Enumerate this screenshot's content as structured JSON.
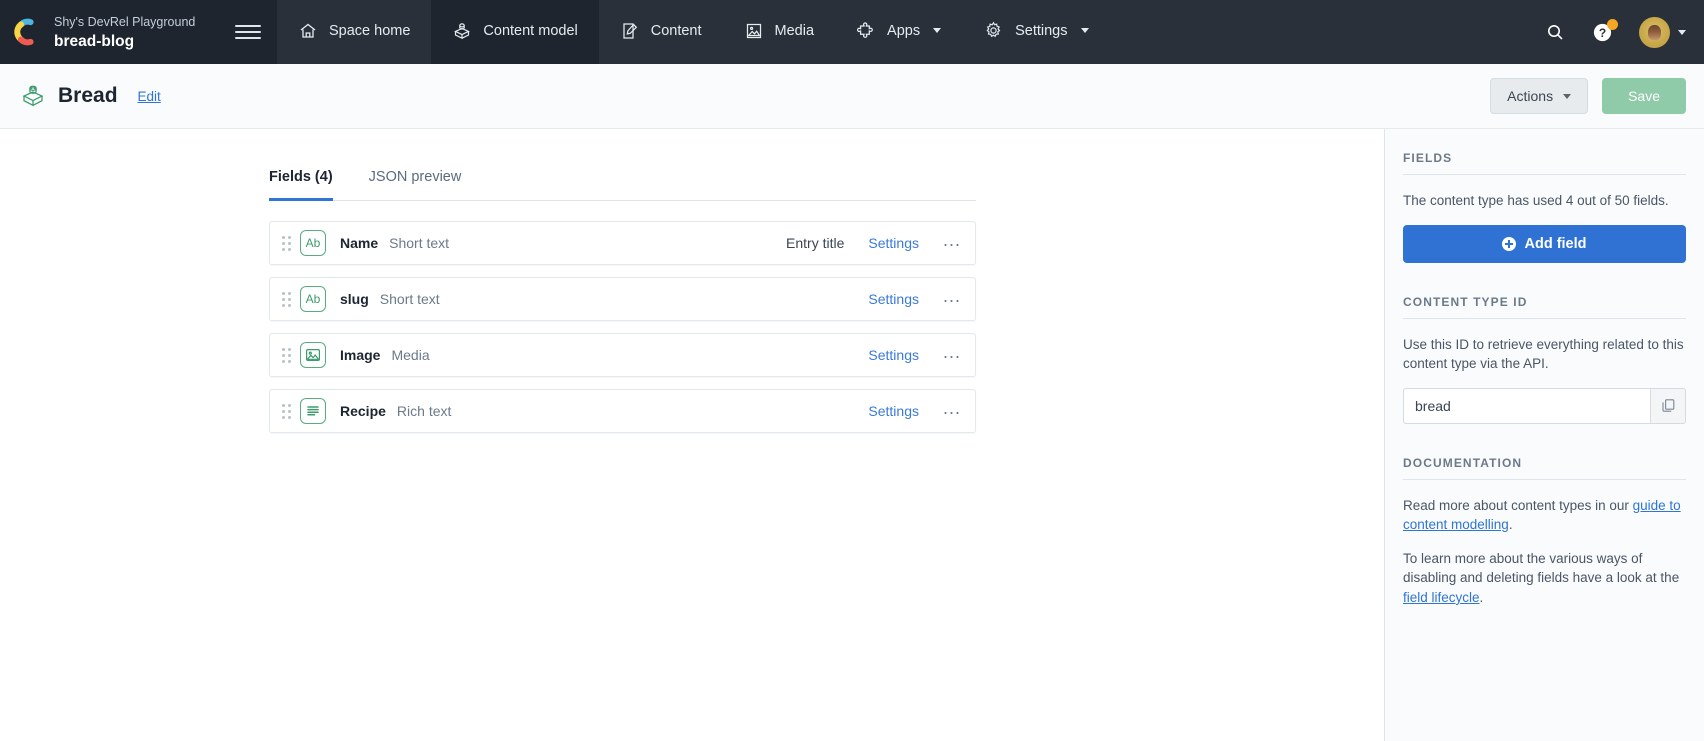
{
  "topnav": {
    "brand": {
      "org": "Shy's DevRel Playground",
      "space": "bread-blog",
      "logo_icon": "contentful-logo-icon",
      "menu_icon": "hamburger-menu-icon"
    },
    "items": [
      {
        "label": "Space home",
        "icon": "home-icon",
        "active": false,
        "caret": false
      },
      {
        "label": "Content model",
        "icon": "content-model-cube-icon",
        "active": true,
        "caret": false
      },
      {
        "label": "Content",
        "icon": "content-pencil-page-icon",
        "active": false,
        "caret": false
      },
      {
        "label": "Media",
        "icon": "media-image-icon",
        "active": false,
        "caret": false
      },
      {
        "label": "Apps",
        "icon": "apps-puzzle-icon",
        "active": false,
        "caret": true
      },
      {
        "label": "Settings",
        "icon": "gear-icon",
        "active": false,
        "caret": true
      }
    ],
    "right": {
      "search_icon": "search-icon",
      "help_icon": "help-question-icon",
      "help_badge": true,
      "avatar": "user-avatar",
      "avatar_caret": true
    }
  },
  "pageheader": {
    "icon": "content-type-cube-icon",
    "title": "Bread",
    "edit_label": "Edit",
    "actions_label": "Actions",
    "save_label": "Save"
  },
  "tabs": [
    {
      "label": "Fields (4)",
      "active": true
    },
    {
      "label": "JSON preview",
      "active": false
    }
  ],
  "fields": [
    {
      "name": "Name",
      "type": "Short text",
      "icon": "short-text-ab-icon",
      "icon_glyph": "Ab",
      "entry_title": "Entry title",
      "settings_label": "Settings",
      "more_label": "..."
    },
    {
      "name": "slug",
      "type": "Short text",
      "icon": "short-text-ab-icon",
      "icon_glyph": "Ab",
      "entry_title": "",
      "settings_label": "Settings",
      "more_label": "..."
    },
    {
      "name": "Image",
      "type": "Media",
      "icon": "media-picture-icon",
      "icon_glyph": "",
      "entry_title": "",
      "settings_label": "Settings",
      "more_label": "..."
    },
    {
      "name": "Recipe",
      "type": "Rich text",
      "icon": "rich-text-lines-icon",
      "icon_glyph": "",
      "entry_title": "",
      "settings_label": "Settings",
      "more_label": "..."
    }
  ],
  "sidebar": {
    "fields_heading": "FIELDS",
    "fields_usage": "The content type has used 4 out of 50 fields.",
    "add_field_label": "Add field",
    "content_type_id_heading": "CONTENT TYPE ID",
    "content_type_id_description": "Use this ID to retrieve everything related to this content type via the API.",
    "content_type_id_value": "bread",
    "copy_icon": "copy-icon",
    "documentation_heading": "DOCUMENTATION",
    "doc_para1_pre": "Read more about content types in our ",
    "doc_para1_link": "guide to content modelling",
    "doc_para1_post": ".",
    "doc_para2_pre": "To learn more about the various ways of disabling and deleting fields have a look at the ",
    "doc_para2_link": "field lifecycle",
    "doc_para2_post": "."
  },
  "colors": {
    "nav_bg": "#2a3039",
    "nav_active_bg": "#1e252e",
    "accent_blue": "#3072d4",
    "link_blue": "#2e75d4",
    "field_green": "#5aab82",
    "save_green": "#8fcaa9",
    "badge_orange": "#f5a623"
  }
}
